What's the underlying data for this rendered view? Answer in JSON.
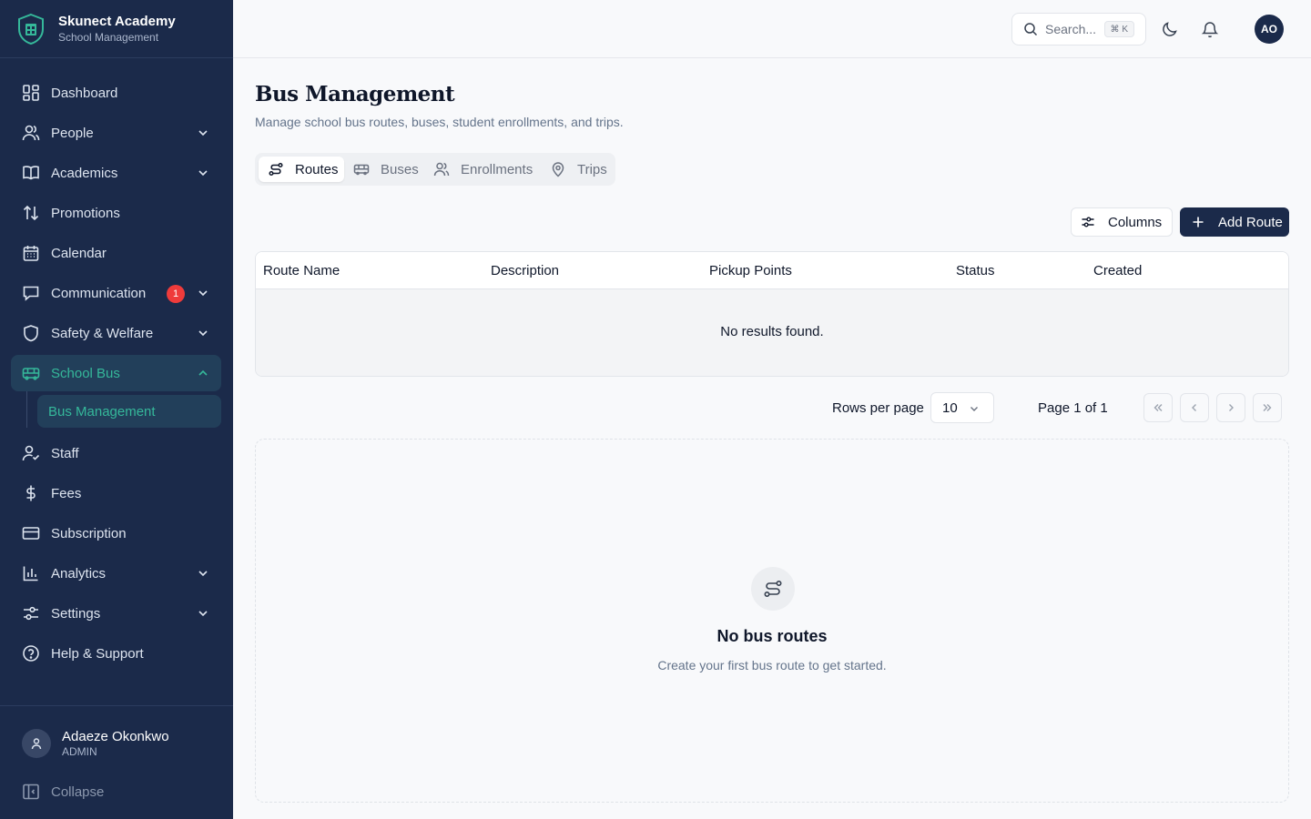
{
  "brand": {
    "name": "Skunect Academy",
    "subtitle": "School Management",
    "logo_icon": "school-shield-icon"
  },
  "sidebar": {
    "items": [
      {
        "label": "Dashboard",
        "icon": "dashboard-icon"
      },
      {
        "label": "People",
        "icon": "people-icon"
      },
      {
        "label": "Academics",
        "icon": "book-icon"
      },
      {
        "label": "Promotions",
        "icon": "arrows-up-down-icon"
      },
      {
        "label": "Calendar",
        "icon": "calendar-icon"
      },
      {
        "label": "Communication",
        "icon": "message-icon",
        "badge": "1"
      },
      {
        "label": "Safety & Welfare",
        "icon": "shield-icon"
      },
      {
        "label": "School Bus",
        "icon": "bus-icon"
      },
      {
        "label": "Bus Management"
      },
      {
        "label": "Staff",
        "icon": "user-check-icon"
      },
      {
        "label": "Fees",
        "icon": "dollar-icon"
      },
      {
        "label": "Subscription",
        "icon": "credit-card-icon"
      },
      {
        "label": "Analytics",
        "icon": "bar-chart-icon"
      },
      {
        "label": "Settings",
        "icon": "sliders-icon"
      },
      {
        "label": "Help & Support",
        "icon": "help-circle-icon"
      }
    ],
    "user": {
      "name": "Adaeze Okonkwo",
      "role": "ADMIN"
    },
    "collapse_label": "Collapse"
  },
  "topbar": {
    "search_placeholder": "Search...",
    "search_shortcut": "⌘ K",
    "avatar_initials": "AO"
  },
  "page": {
    "title": "Bus Management",
    "subtitle": "Manage school bus routes, buses, student enrollments, and trips."
  },
  "tabs": [
    {
      "label": "Routes",
      "active": true
    },
    {
      "label": "Buses"
    },
    {
      "label": "Enrollments"
    },
    {
      "label": "Trips"
    }
  ],
  "toolbar": {
    "columns_label": "Columns",
    "add_label": "Add Route"
  },
  "table": {
    "headers": [
      "Route Name",
      "Description",
      "Pickup Points",
      "Status",
      "Created"
    ],
    "empty_text": "No results found."
  },
  "pagination": {
    "rows_per_page_label": "Rows per page",
    "rows_per_page_value": "10",
    "page_info": "Page 1 of 1"
  },
  "empty_state": {
    "title": "No bus routes",
    "text": "Create your first bus route to get started."
  },
  "colors": {
    "sidebar_bg": "#1b2a4a",
    "accent": "#35b89a",
    "badge": "#ef3b3b"
  }
}
